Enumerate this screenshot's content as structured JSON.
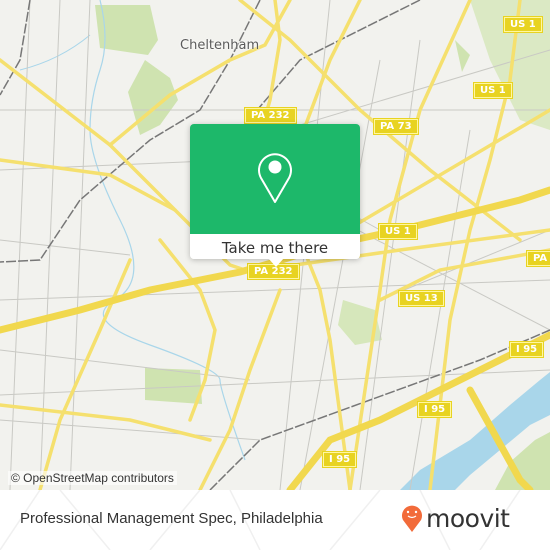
{
  "map": {
    "place_labels": [
      {
        "name": "Cheltenham"
      }
    ],
    "route_shields": [
      {
        "label": "PA 232"
      },
      {
        "label": "PA 73"
      },
      {
        "label": "US 1"
      },
      {
        "label": "US 1"
      },
      {
        "label": "US 1"
      },
      {
        "label": "PA 232"
      },
      {
        "label": "US 13"
      },
      {
        "label": "PA"
      },
      {
        "label": "I 95"
      },
      {
        "label": "I 95"
      },
      {
        "label": "I 95"
      }
    ],
    "attribution": "© OpenStreetMap contributors",
    "colors": {
      "background": "#f2f2ee",
      "road_major": "#f5e06e",
      "road_minor": "#bdbdbd",
      "park": "#cfe3b0",
      "water": "#a9d6ea",
      "rail": "#777777"
    }
  },
  "popup": {
    "icon": "location-pin-icon",
    "action_label": "Take me there",
    "accent_color": "#1db86a"
  },
  "footer": {
    "title": "Professional Management Spec, Philadelphia",
    "brand": "moovit",
    "brand_icon": "moovit-pin-icon",
    "brand_color": "#f26b3a"
  }
}
